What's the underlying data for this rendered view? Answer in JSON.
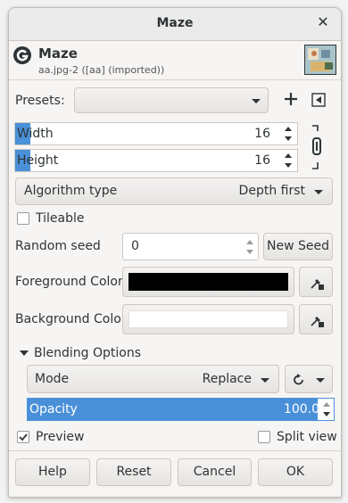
{
  "window": {
    "title": "Maze"
  },
  "header": {
    "name": "Maze",
    "subtitle": "aa.jpg-2 ([aa] (imported))"
  },
  "presets": {
    "label": "Presets:",
    "value": ""
  },
  "width": {
    "label": "Width",
    "value": "16",
    "fill_fraction": 0.06
  },
  "height": {
    "label": "Height",
    "value": "16",
    "fill_fraction": 0.06
  },
  "algorithm": {
    "label": "Algorithm type",
    "value": "Depth first"
  },
  "tileable": {
    "label": "Tileable",
    "checked": false
  },
  "random_seed": {
    "label": "Random seed",
    "value": "0",
    "new_seed_label": "New Seed"
  },
  "foreground": {
    "label": "Foreground Color",
    "color": "#000000"
  },
  "background": {
    "label": "Background Color",
    "color": "#ffffff"
  },
  "blending": {
    "label": "Blending Options",
    "mode_label": "Mode",
    "mode_value": "Replace",
    "opacity_label": "Opacity",
    "opacity_value": "100.0",
    "opacity_fraction": 1.0
  },
  "preview": {
    "label": "Preview",
    "checked": true
  },
  "split_view": {
    "label": "Split view",
    "checked": false
  },
  "buttons": {
    "help": "Help",
    "reset": "Reset",
    "cancel": "Cancel",
    "ok": "OK"
  },
  "colors": {
    "accent": "#4a90d9",
    "text": "#2e3436"
  }
}
